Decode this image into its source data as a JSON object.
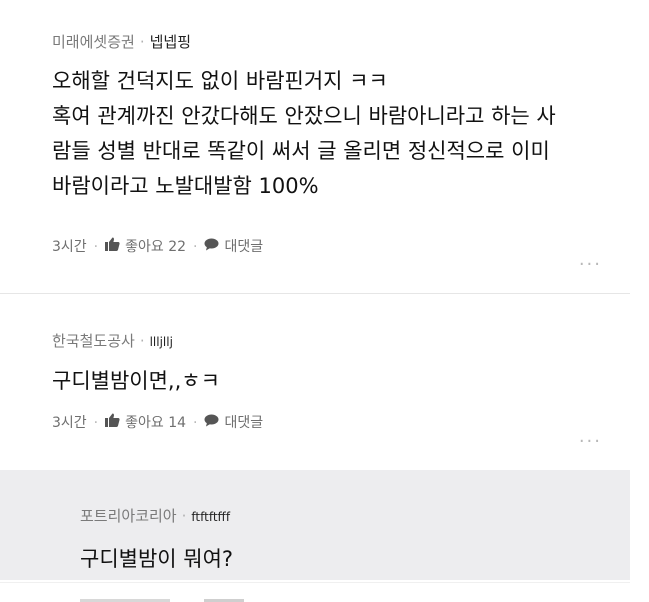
{
  "comments": [
    {
      "company": "미래에셋증권",
      "nickname": "넵넵핑",
      "lines": [
        "오해할 건덕지도 없이 바람핀거지 ㅋㅋ",
        "혹여 관계까진 안갔다해도 안잤으니 바람아니라고 하는 사",
        "람들 성별 반대로 똑같이 써서 글 올리면 정신적으로 이미",
        "바람이라고 노발대발함 100%"
      ],
      "time": "3시간",
      "like_label": "좋아요 22",
      "reply_label": "대댓글",
      "more": "..."
    },
    {
      "company": "한국철도공사",
      "nickname": "llljllj",
      "lines": [
        "구디별밤이면,,ㅎㅋ"
      ],
      "time": "3시간",
      "like_label": "좋아요 14",
      "reply_label": "대댓글",
      "more": "..."
    },
    {
      "company": "포트리아코리아",
      "nickname": "ftftftfff",
      "lines": [
        "구디별밤이 뭐여?"
      ]
    }
  ],
  "icons": {
    "like": "thumbs-up-icon",
    "reply": "speech-bubble-icon",
    "more": "ellipsis-icon"
  }
}
